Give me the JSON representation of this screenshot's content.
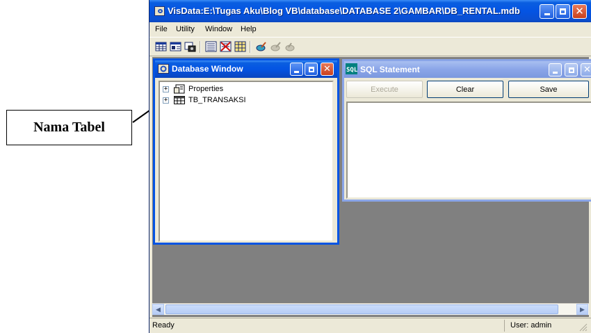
{
  "annotation": {
    "label": "Nama Tabel"
  },
  "app": {
    "title": "VisData:E:\\Tugas Aku\\Blog VB\\database\\DATABASE 2\\GAMBAR\\DB_RENTAL.mdb",
    "menu": [
      "File",
      "Utility",
      "Window",
      "Help"
    ]
  },
  "database_window": {
    "title": "Database Window",
    "items": [
      {
        "label": "Properties",
        "icon": "properties-icon"
      },
      {
        "label": "TB_TRANSAKSI",
        "icon": "table-icon"
      }
    ]
  },
  "sql_window": {
    "title": "SQL Statement",
    "buttons": {
      "execute": "Execute",
      "clear": "Clear",
      "save": "Save"
    },
    "text": ""
  },
  "status": {
    "left": "Ready",
    "right": "User: admin"
  },
  "colors": {
    "title_active": "#0454e3",
    "mdi_background": "#808080",
    "chrome": "#ece9d8"
  }
}
